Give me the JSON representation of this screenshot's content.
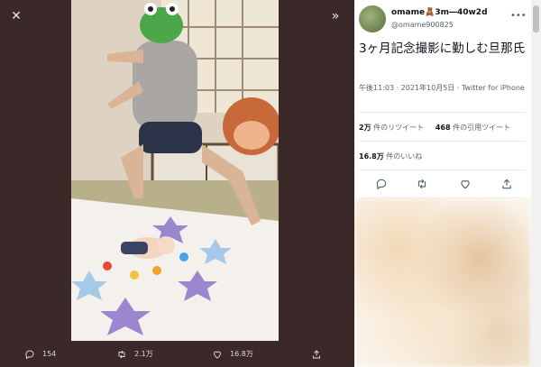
{
  "media": {
    "close_icon": "close-icon",
    "expand_icon": "chevron-double-right-icon",
    "actions": {
      "reply_count": "154",
      "retweet_count": "2.1万",
      "like_count": "16.8万"
    }
  },
  "tweet": {
    "display_name": "omame🧸3m―40w2d",
    "handle": "@omame900825",
    "text": "3ヶ月記念撮影に勤しむ旦那氏",
    "meta": "午後11:03 · 2021年10月5日 · Twitter for iPhone",
    "retweets_value": "2万",
    "retweets_label": "件のリツイート",
    "quotes_value": "468",
    "quotes_label": "件の引用ツイート",
    "likes_value": "16.8万",
    "likes_label": "件のいいね"
  },
  "colors": {
    "overlay_bg": "#3b2828",
    "panel_bg": "#ffffff",
    "text_primary": "#0f1419",
    "text_secondary": "#536471"
  }
}
